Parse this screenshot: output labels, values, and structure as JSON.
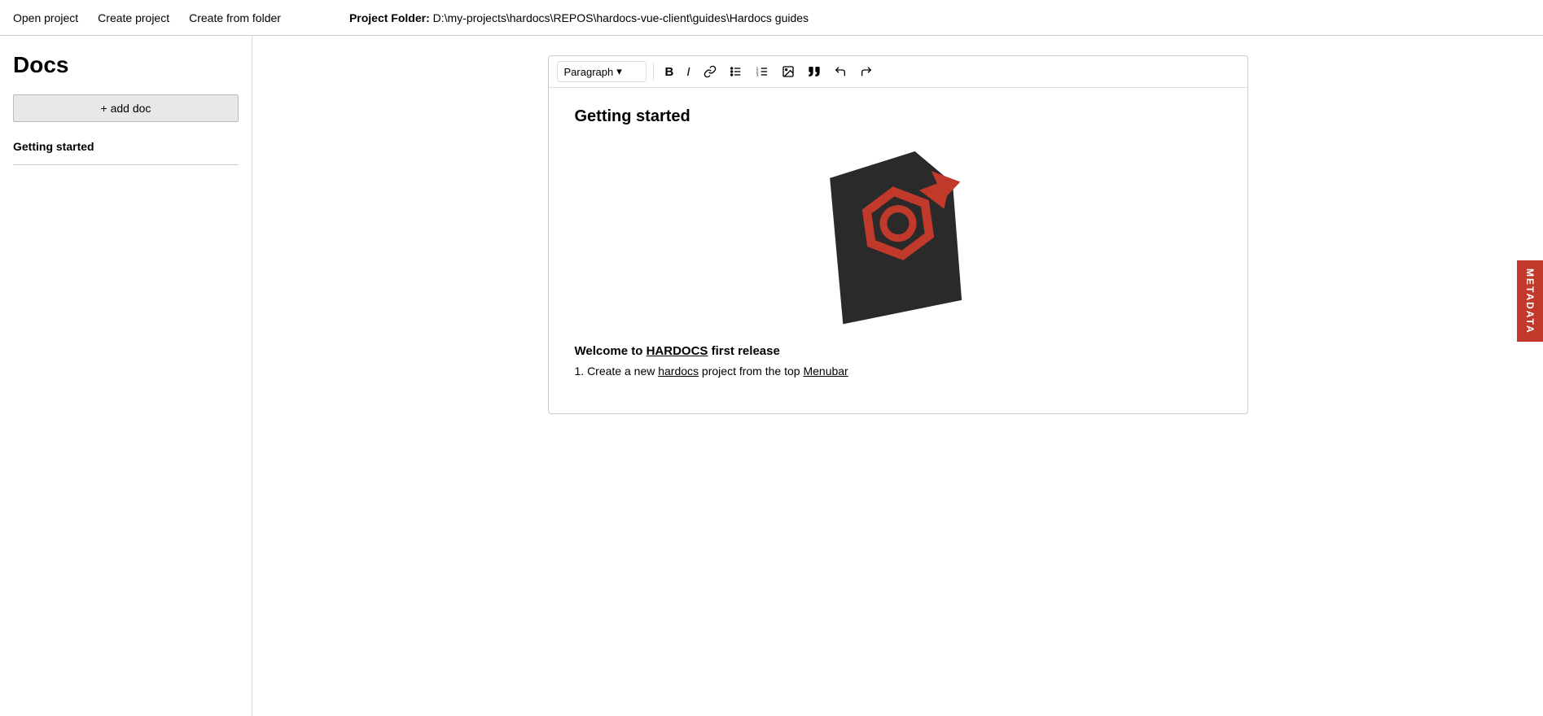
{
  "menubar": {
    "open_project": "Open project",
    "create_project": "Create project",
    "create_from_folder": "Create from folder",
    "project_folder_label": "Project Folder:",
    "project_folder_path": "D:\\my-projects\\hardocs\\REPOS\\hardocs-vue-client\\guides\\Hardocs guides"
  },
  "sidebar": {
    "title": "Docs",
    "add_doc_label": "+ add doc",
    "docs": [
      {
        "name": "Getting started"
      }
    ]
  },
  "toolbar": {
    "paragraph_label": "Paragraph",
    "chevron": "▾",
    "bold": "B",
    "italic": "I",
    "link": "🔗",
    "bullet_list": "≡",
    "ordered_list": "≡",
    "image": "🖼",
    "quote": "❝",
    "undo": "↩",
    "redo": "↪"
  },
  "editor": {
    "doc_title": "Getting started",
    "welcome_text_prefix": "Welcome to ",
    "hardocs_brand": "HARDOCS",
    "welcome_text_suffix": " first release",
    "step1_prefix": "1. Create a new ",
    "hardocs_link": "hardocs",
    "step1_suffix": " project from the top ",
    "menubar_link": "Menubar"
  },
  "metadata_tab": {
    "label": "METADATA"
  }
}
